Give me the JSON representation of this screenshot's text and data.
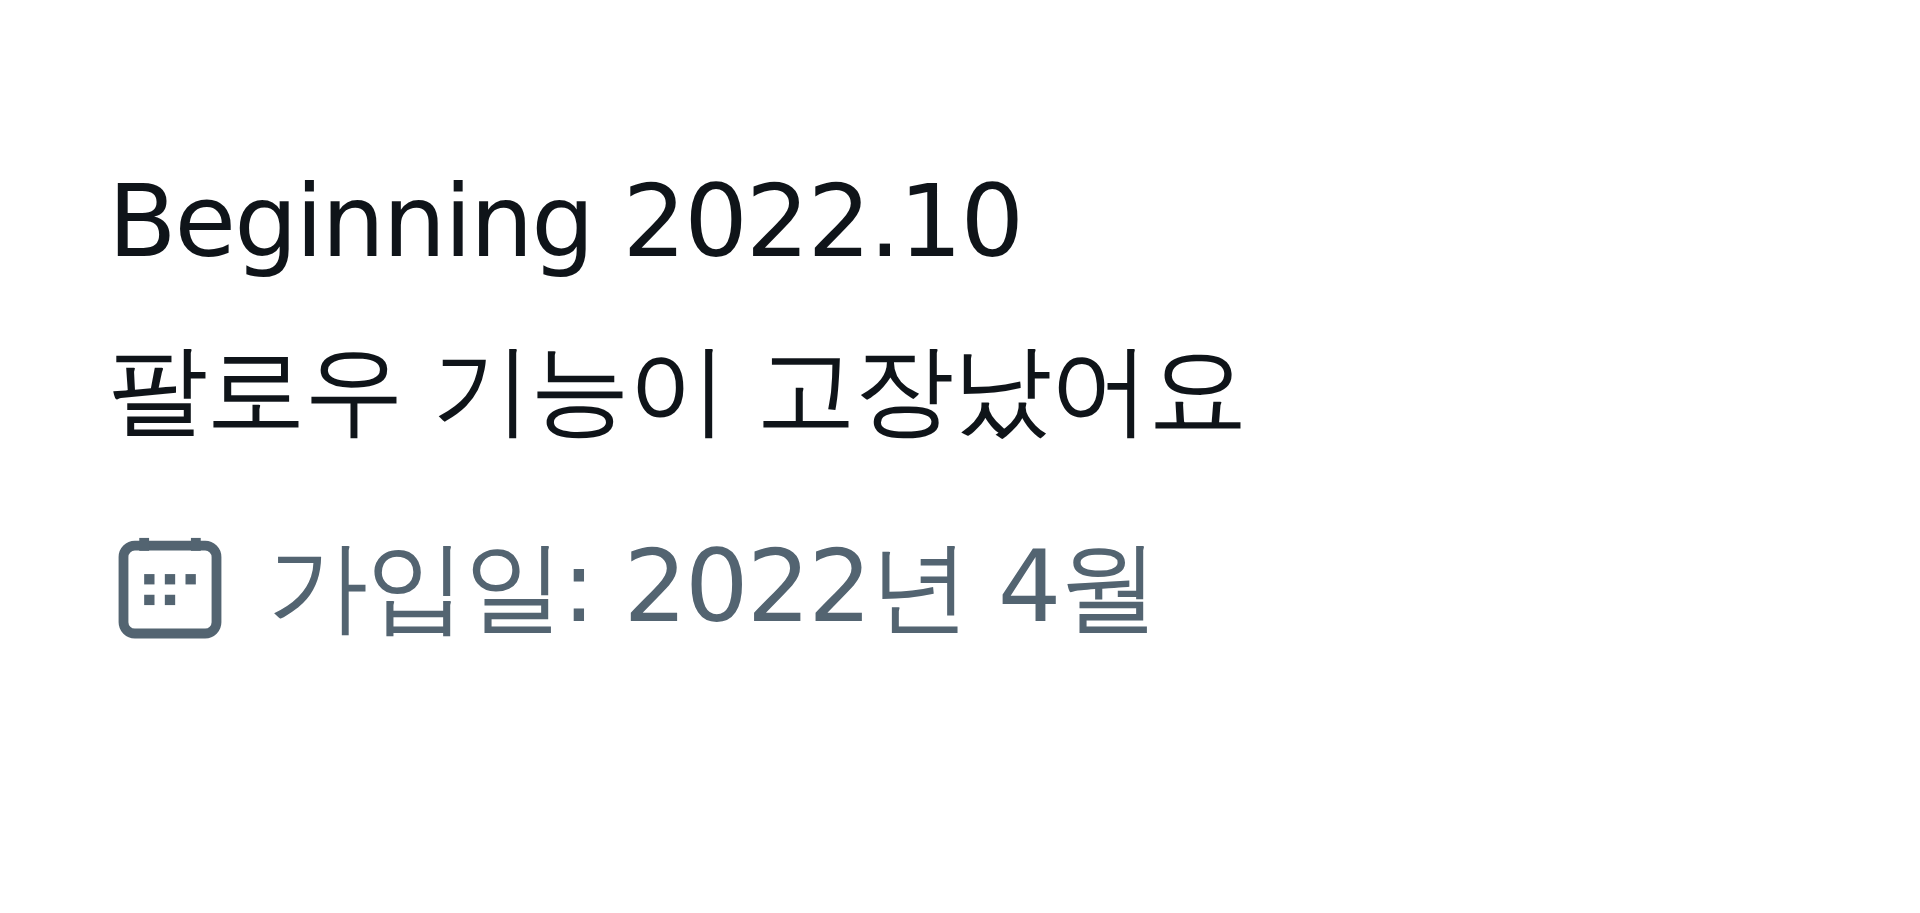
{
  "bio": [
    "Beginning 2022.10",
    "팔로우 기능이 고장났어요"
  ],
  "joined": "가입일: 2022년 4월"
}
